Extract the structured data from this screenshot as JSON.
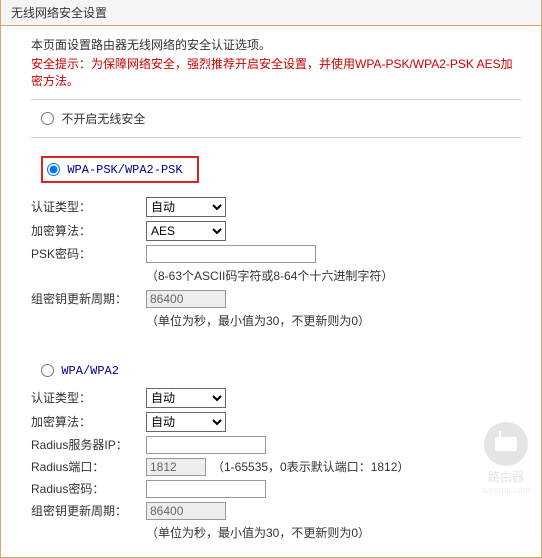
{
  "title": "无线网络安全设置",
  "intro": "本页面设置路由器无线网络的安全认证选项。",
  "warning": "安全提示：为保障网络安全，强烈推荐开启安全设置，并使用WPA-PSK/WPA2-PSK AES加密方法。",
  "radios": {
    "none": "不开启无线安全",
    "psk": "WPA-PSK/WPA2-PSK",
    "wpa": "WPA/WPA2"
  },
  "labels": {
    "auth_type": "认证类型：",
    "cipher": "加密算法：",
    "psk_pw": "PSK密码：",
    "group_key": "组密钥更新周期：",
    "radius_ip": "Radius服务器IP：",
    "radius_port": "Radius端口：",
    "radius_pw": "Radius密码："
  },
  "psk_section": {
    "auth_type": "自动",
    "cipher": "AES",
    "password": "",
    "pw_hint": "（8-63个ASCII码字符或8-64个十六进制字符）",
    "group_key": "86400",
    "group_key_hint": "（单位为秒，最小值为30，不更新则为0）"
  },
  "wpa_section": {
    "auth_type": "自动",
    "cipher": "自动",
    "radius_ip": "",
    "radius_port": "1812",
    "radius_port_hint": "（1-65535，0表示默认端口：1812）",
    "radius_pw": "",
    "group_key": "86400",
    "group_key_hint": "（单位为秒，最小值为30，不更新则为0）"
  },
  "watermark": {
    "line1": "路由器",
    "line2": "luyouqi.com"
  }
}
